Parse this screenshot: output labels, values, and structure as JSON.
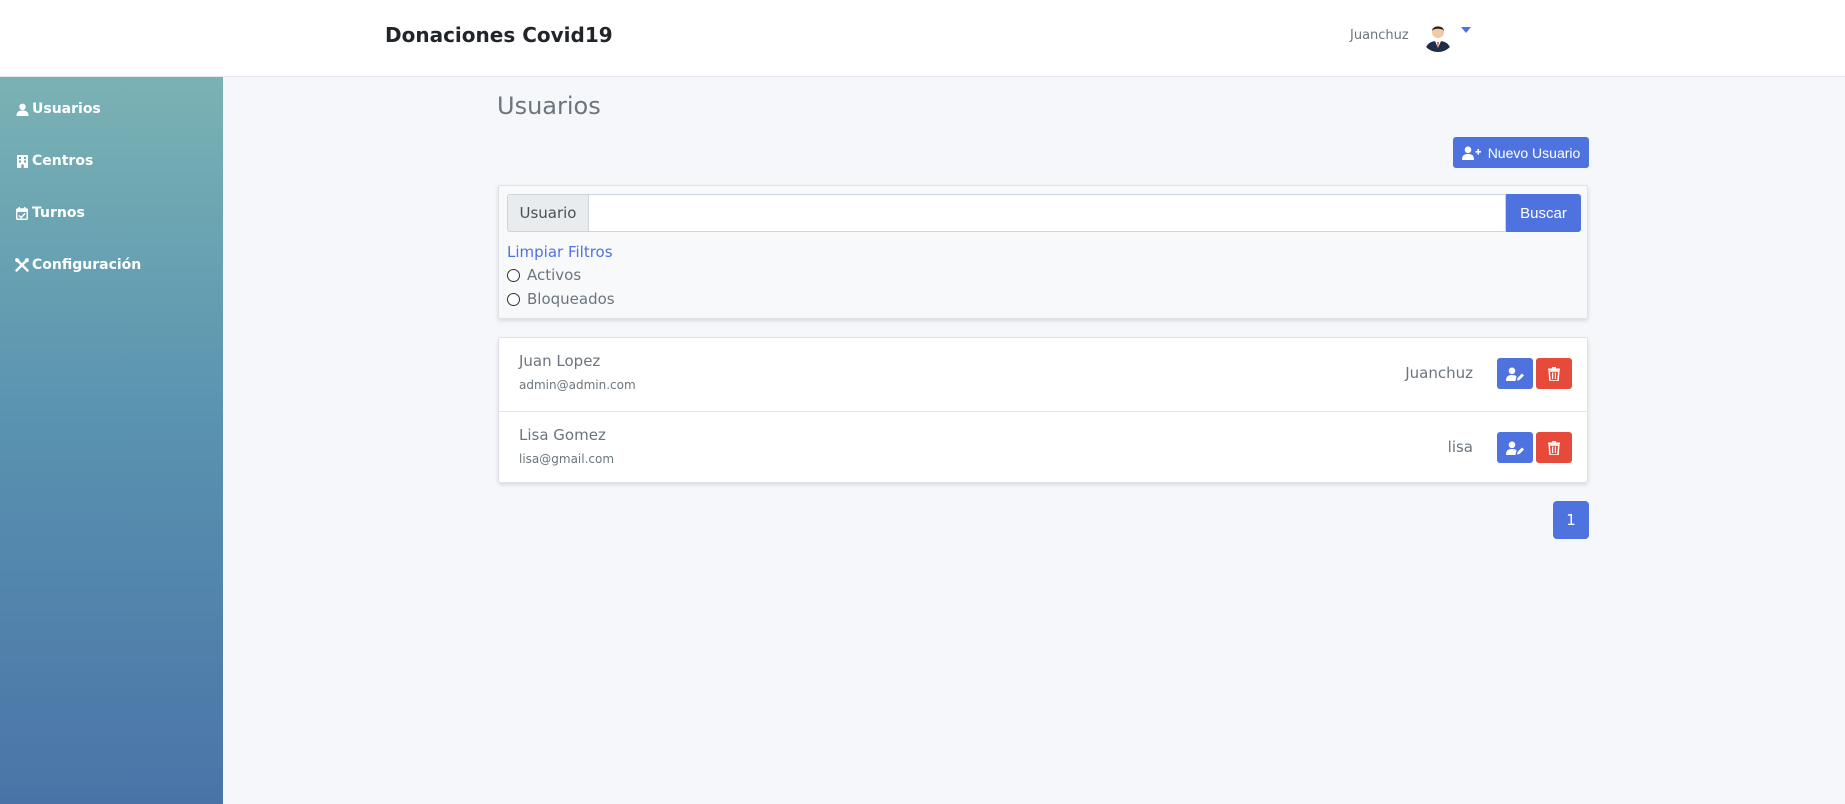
{
  "header": {
    "title": "Donaciones Covid19",
    "user_name": "Juanchuz"
  },
  "sidebar": {
    "items": [
      {
        "label": "Usuarios",
        "icon": "user-icon"
      },
      {
        "label": "Centros",
        "icon": "building-icon"
      },
      {
        "label": "Turnos",
        "icon": "calendar-check-icon"
      },
      {
        "label": "Configuración",
        "icon": "tools-icon"
      }
    ]
  },
  "main": {
    "title": "Usuarios",
    "new_button_label": "Nuevo Usuario",
    "filter": {
      "input_label": "Usuario",
      "input_value": "",
      "search_label": "Buscar",
      "clear_label": "Limpiar Filtros",
      "options": [
        "Activos",
        "Bloqueados"
      ]
    },
    "users": [
      {
        "name": "Juan Lopez",
        "email": "admin@admin.com",
        "username": "Juanchuz"
      },
      {
        "name": "Lisa Gomez",
        "email": "lisa@gmail.com",
        "username": "lisa"
      }
    ],
    "pagination": {
      "current_page": "1"
    }
  },
  "colors": {
    "primary": "#4e73df",
    "danger": "#e74a3b",
    "sidebar_top": "#7ab2b4",
    "sidebar_bottom": "#4a74a8"
  }
}
